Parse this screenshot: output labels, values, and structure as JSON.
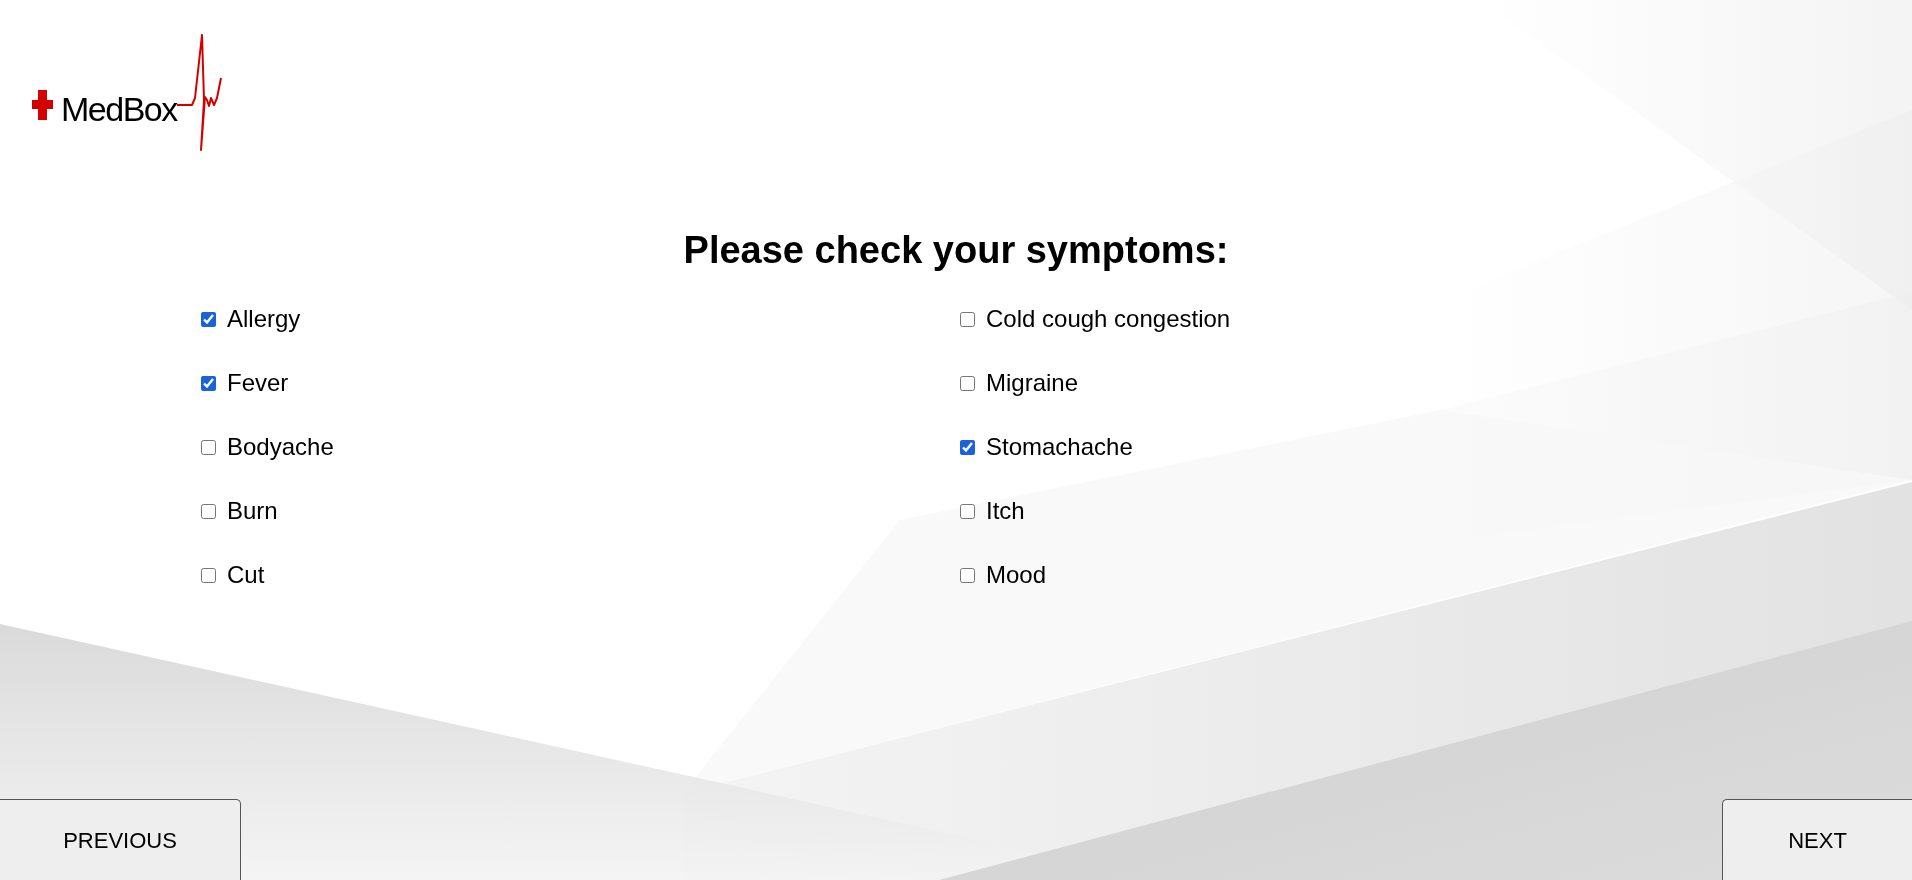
{
  "logo": {
    "text": "MedBox"
  },
  "heading": "Please check your symptoms:",
  "columns": [
    {
      "symptoms": [
        {
          "label": "Allergy",
          "checked": true
        },
        {
          "label": "Fever",
          "checked": true
        },
        {
          "label": "Bodyache",
          "checked": false
        },
        {
          "label": "Burn",
          "checked": false
        },
        {
          "label": "Cut",
          "checked": false
        }
      ]
    },
    {
      "symptoms": [
        {
          "label": "Cold cough congestion",
          "checked": false
        },
        {
          "label": "Migraine",
          "checked": false
        },
        {
          "label": "Stomachache",
          "checked": true
        },
        {
          "label": "Itch",
          "checked": false
        },
        {
          "label": "Mood",
          "checked": false
        }
      ]
    }
  ],
  "buttons": [
    {
      "label": "PREVIOUS"
    },
    {
      "label": "NEXT"
    }
  ]
}
